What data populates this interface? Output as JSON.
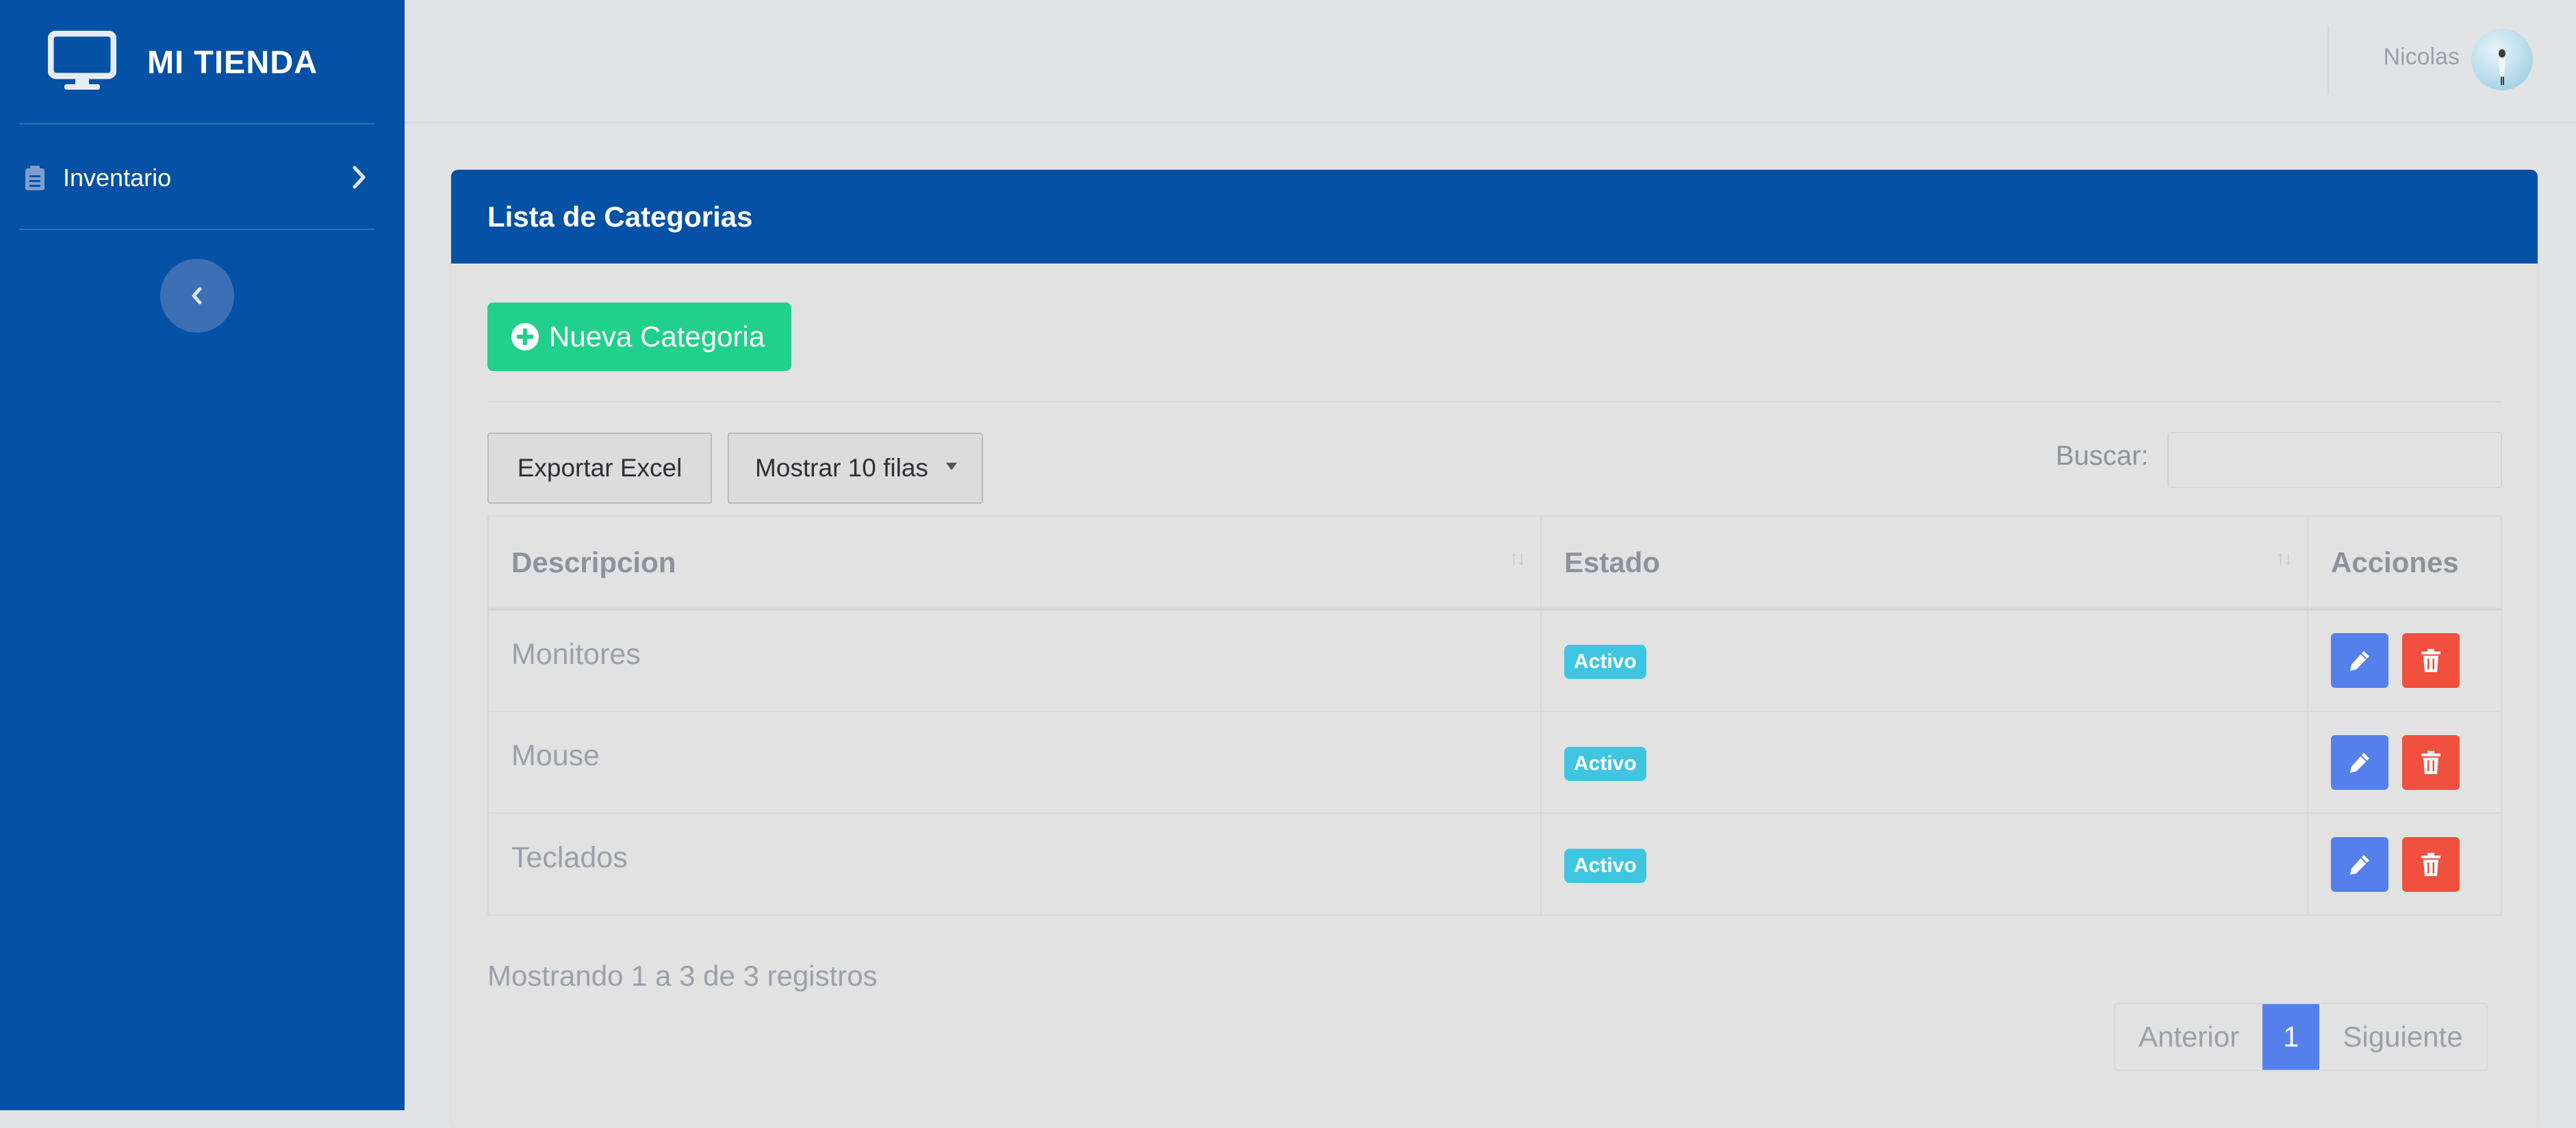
{
  "brand": {
    "title": "MI TIENDA",
    "icon": "monitor-icon"
  },
  "sidebar": {
    "items": [
      {
        "label": "Inventario",
        "icon": "clipboard-icon"
      }
    ],
    "toggle_icon": "chevron-left-icon"
  },
  "topbar": {
    "user_name": "Nicolas"
  },
  "card": {
    "title": "Lista de Categorias",
    "new_button_label": "Nueva Categoria",
    "export_label": "Exportar Excel",
    "rows_select_label": "Mostrar 10 filas",
    "search_label": "Buscar:",
    "search_value": ""
  },
  "table": {
    "headers": [
      "Descripcion",
      "Estado",
      "Acciones"
    ],
    "rows": [
      {
        "descripcion": "Monitores",
        "estado": "Activo"
      },
      {
        "descripcion": "Mouse",
        "estado": "Activo"
      },
      {
        "descripcion": "Teclados",
        "estado": "Activo"
      }
    ]
  },
  "footer": {
    "info": "Mostrando 1 a 3 de 3 registros",
    "prev": "Anterior",
    "page": "1",
    "next": "Siguiente"
  },
  "colors": {
    "sidebar": "#0451a5",
    "header": "#0451a5",
    "new_button": "#21d08b",
    "badge": "#3fc5e0",
    "edit": "#5580ec",
    "delete": "#f0503e"
  }
}
